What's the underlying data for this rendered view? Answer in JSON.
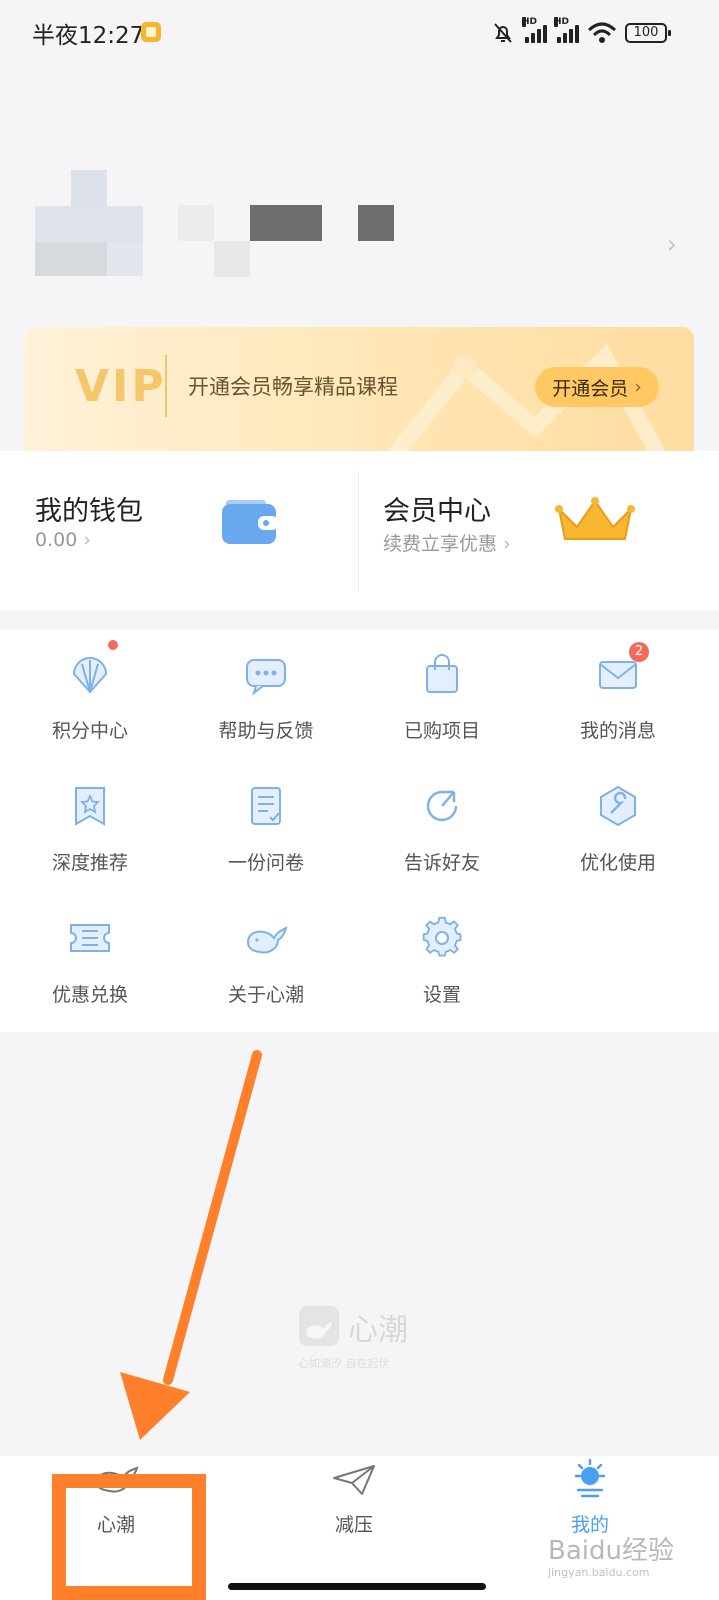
{
  "status_bar": {
    "time": "半夜12:27",
    "battery": "100",
    "hd_label": "HD"
  },
  "vip_banner": {
    "logo_text": "VIP",
    "description": "开通会员畅享精品课程",
    "button_label": "开通会员",
    "chevron": "›"
  },
  "wallet": {
    "title": "我的钱包",
    "value": "0.00",
    "chevron": "›"
  },
  "member_center": {
    "title": "会员中心",
    "subtitle": "续费立享优惠",
    "chevron": "›"
  },
  "grid": {
    "points": "积分中心",
    "help": "帮助与反馈",
    "purchased": "已购项目",
    "messages": "我的消息",
    "messages_badge": "2",
    "recommend": "深度推荐",
    "survey": "一份问卷",
    "tell_friends": "告诉好友",
    "optimize": "优化使用",
    "coupon": "优惠兑换",
    "about": "关于心潮",
    "settings": "设置"
  },
  "watermark": {
    "title": "心潮",
    "subtitle": "心如潮汐 自在起伏"
  },
  "bottom_nav": {
    "home": "心潮",
    "relax": "减压",
    "me": "我的"
  },
  "baidu_watermark": {
    "text": "Baidu经验",
    "url": "jingyan.baidu.com"
  },
  "colors": {
    "accent_blue": "#5aa2f0",
    "icon_blue": "#7fb1e6",
    "highlight_orange": "#ff7f2a",
    "vip_gold": "#ffc862",
    "badge_red": "#f36a5a"
  }
}
